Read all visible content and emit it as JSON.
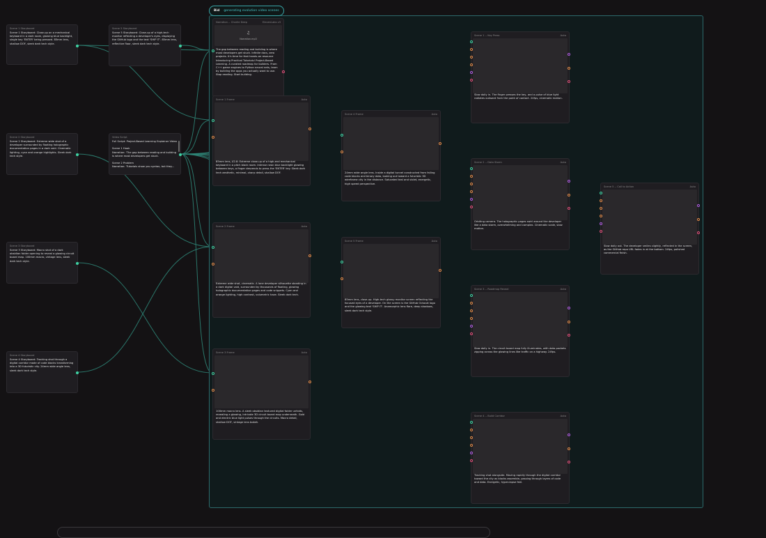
{
  "group": {
    "tag": "Bid",
    "name": "generating evolution video scenes"
  },
  "colors": {
    "canvas": "#141214",
    "group_border": "#2d6a6b",
    "link_teal": "#2f8a7a",
    "link_orange": "#c07a40",
    "port_teal": "#3fd3a3"
  },
  "storyboards": [
    {
      "title": "Scene 1 Storyboard",
      "text": "Scene 1 Storyboard: Close-up on a mechanical keyboard in a dark room, glowing blue backlight, single key 'ENTER' being pressed. 85mm lens, shallow DOF, sleek dark tech style."
    },
    {
      "title": "Scene 2 Storyboard",
      "text": "Scene 2 Storyboard: Extreme wide shot of a developer surrounded by floating holographic documentation pages in a dark void. Cinematic lighting, cyan and orange highlights. Sleek dark tech style."
    },
    {
      "title": "Scene 3 Storyboard",
      "text": "Scene 3 Storyboard: Macro shot of a dark obsidian folder opening to reveal a glowing circuit board map. 100mm macro, vintage lens, sleek dark tech style."
    },
    {
      "title": "Scene 4 Storyboard",
      "text": "Scene 4 Storyboard: Tracking shot through a digital corridor made of code blocks transforming into a 3D futuristic city. 24mm wide angle lens, sleek dark tech style."
    },
    {
      "title": "Scene 5 Storyboard",
      "text": "Scene 5 Storyboard: Close-up of a high-tech monitor reflecting a developer's eyes, displaying the GitHub logo and the text 'SHIP IT'. 85mm lens, reflective floor, sleek dark tech style."
    }
  ],
  "video_script": {
    "title": "Video Script",
    "text": "Full Script: Project-Based Learning Explainer Video\n\nScene 1 Hook\nNarration: 'The gap between reading and building is where most developers get stuck.\n\nScene 2 Problem\nNarration: 'Tutorials show you syntax, but they..."
  },
  "narration": {
    "title": "Narration -- Charlie Deep",
    "badge": "ElevenLabs v3",
    "filename": "Narration.mp3",
    "text": "The gap between reading and building is where most developers get stuck. Infinite docs, zero projects. It's time for that hands-on resource Introducing Practical Tutorials! Project-Based Learning. A curated roadmap for builders. From C++ game engines to Python neural nets, learn by building the apps you actually want to use. Stop reading. Start building."
  },
  "frames": [
    {
      "title": "Scene 1 Frame",
      "badge": "Auto",
      "caption": "85mm lens, f/2.8: Extreme close-up of a high-end mechanical keyboard in a pitch black room. Intense neon blue backlight glowing between keys, a finger descends to press the 'ENTER' key. Sleek dark tech aesthetic, minimal, sharp detail, shallow DOF."
    },
    {
      "title": "Scene 2 Frame",
      "badge": "Auto",
      "caption": "Extreme wide shot, cinematic. A lone developer silhouette standing in a dark digital void, surrounded by thousands of floating, glowing holographic documentation pages and code snippets. Cyan and orange lighting, high contrast, volumetric haze. Sleek dark tech."
    },
    {
      "title": "Scene 3 Frame",
      "badge": "Auto",
      "caption": "100mm macro lens. A sleek obsidian textured digital folder unfolds, revealing a glowing, intricate 3D circuit board map underneath. Gold and electric blue light pulses through the circuits. Macro detail, shallow DOF, vintage lens bokeh."
    },
    {
      "title": "Scene 4 Frame",
      "badge": "Auto",
      "caption": "24mm wide angle lens. Inside a digital tunnel constructed from falling code blocks and binary data, looking out toward a futuristic 3D wireframe city in the distance. Saturated teal and violet, energetic, high speed perspective."
    },
    {
      "title": "Scene 5 Frame",
      "badge": "Auto",
      "caption": "85mm lens, close-up. High-tech glossy monitor screen reflecting the focused eyes of a developer. On the screen is the GitHub Octocat logo and the glowing text 'SHIP IT'. Anamorphic lens flare, deep shadows, sleek dark tech style."
    }
  ],
  "videos": [
    {
      "title": "Scene 1 -- Key Press",
      "badge": "Auto",
      "caption": "Slow dolly in. The finger presses the key, and a pulse of blue light radiates outward from the point of contact. 24fps, cinematic motion."
    },
    {
      "title": "Scene 2 -- Data Storm",
      "badge": "Auto",
      "caption": "Orbiting camera. The holographic pages swirl around the developer like a data storm, overwhelming and complex. Cinematic scale, slow motion."
    },
    {
      "title": "Scene 3 -- Roadmap Reveal",
      "badge": "Auto",
      "caption": "Slow dolly in. The circuit board map fully illuminates, with data packets zipping across the glowing lines like traffic on a highway. 24fps."
    },
    {
      "title": "Scene 4 -- Build Corridor",
      "badge": "Auto",
      "caption": "Tracking shot alongside. Moving rapidly through the digital corridor toward the city as blocks assemble, passing through layers of code and data. Energetic, hyper-lapse feel."
    },
    {
      "title": "Scene 5 -- Call to Action",
      "badge": "Auto",
      "caption": "Slow dolly out. The developer smiles slightly, reflected in the screen, as the GitHub repo URL fades in at the bottom. 24fps, polished commercial finish."
    }
  ]
}
